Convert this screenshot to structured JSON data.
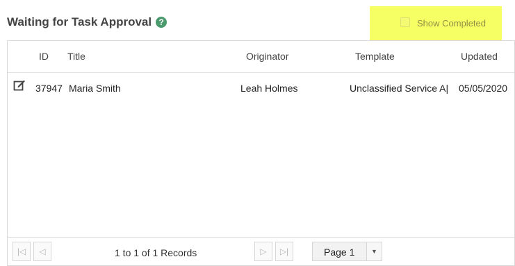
{
  "header": {
    "title": "Waiting for Task Approval",
    "help_icon": "?",
    "show_completed_label": "Show Completed",
    "highlight_color": "#f6ff5c"
  },
  "table": {
    "columns": [
      "ID",
      "Title",
      "Originator",
      "Template",
      "Updated"
    ],
    "rows": [
      {
        "icon": "edit-icon",
        "id": "37947",
        "title": "Maria Smith",
        "originator": "Leah Holmes",
        "template": "Unclassified Service A|",
        "updated": "05/05/2020"
      }
    ]
  },
  "pager": {
    "records_text": "1 to 1 of 1 Records",
    "page_label": "Page 1",
    "first_icon": "|◁",
    "prev_icon": "◁",
    "next_icon": "▷",
    "last_icon": "▷|",
    "caret": "▼"
  }
}
